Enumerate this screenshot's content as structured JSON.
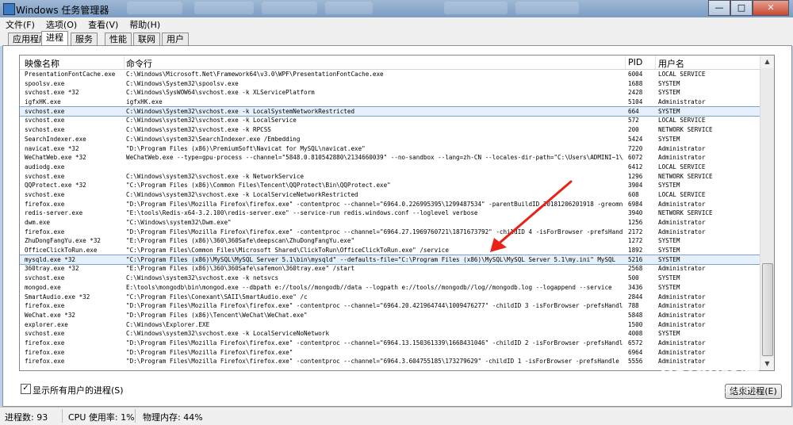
{
  "window": {
    "title": "Windows 任务管理器",
    "min": "—",
    "max": "□",
    "close": "✕"
  },
  "menu": [
    "文件(F)",
    "选项(O)",
    "查看(V)",
    "帮助(H)"
  ],
  "tabs": [
    "应用程序",
    "进程",
    "服务",
    "性能",
    "联网",
    "用户"
  ],
  "active_tab": 1,
  "columns": {
    "name": "映像名称",
    "cmd": "命令行",
    "pid": "PID",
    "user": "用户名"
  },
  "processes": [
    {
      "name": "PresentationFontCache.exe",
      "cmd": "C:\\Windows\\Microsoft.Net\\Framework64\\v3.0\\WPF\\PresentationFontCache.exe",
      "pid": "6004",
      "user": "LOCAL SERVICE"
    },
    {
      "name": "spoolsv.exe",
      "cmd": "C:\\Windows\\System32\\spoolsv.exe",
      "pid": "1688",
      "user": "SYSTEM"
    },
    {
      "name": "svchost.exe *32",
      "cmd": "C:\\Windows\\SysWOW64\\svchost.exe -k XLServicePlatform",
      "pid": "2428",
      "user": "SYSTEM"
    },
    {
      "name": "igfxHK.exe",
      "cmd": "igfxHK.exe",
      "pid": "5104",
      "user": "Administrator"
    },
    {
      "name": "svchost.exe",
      "cmd": "C:\\Windows\\System32\\svchost.exe -k LocalSystemNetworkRestricted",
      "pid": "664",
      "user": "SYSTEM"
    },
    {
      "name": "svchost.exe",
      "cmd": "C:\\Windows\\system32\\svchost.exe -k LocalService",
      "pid": "572",
      "user": "LOCAL SERVICE"
    },
    {
      "name": "svchost.exe",
      "cmd": "C:\\Windows\\system32\\svchost.exe -k RPCSS",
      "pid": "200",
      "user": "NETWORK SERVICE"
    },
    {
      "name": "SearchIndexer.exe",
      "cmd": "C:\\Windows\\system32\\SearchIndexer.exe /Embedding",
      "pid": "5424",
      "user": "SYSTEM"
    },
    {
      "name": "navicat.exe *32",
      "cmd": "\"D:\\Program Files (x86)\\PremiumSoft\\Navicat for MySQL\\navicat.exe\"",
      "pid": "7220",
      "user": "Administrator"
    },
    {
      "name": "WeChatWeb.exe *32",
      "cmd": "WeChatWeb.exe --type=gpu-process --channel=\"5848.0.810542880\\2134660039\" --no-sandbox --lang=zh-CN --locales-dir-path=\"C:\\Users\\ADMINI~1\\A...",
      "pid": "6072",
      "user": "Administrator"
    },
    {
      "name": "audiodg.exe",
      "cmd": "",
      "pid": "6412",
      "user": "LOCAL SERVICE"
    },
    {
      "name": "svchost.exe",
      "cmd": "C:\\Windows\\system32\\svchost.exe -k NetworkService",
      "pid": "1296",
      "user": "NETWORK SERVICE"
    },
    {
      "name": "QQProtect.exe *32",
      "cmd": "\"C:\\Program Files (x86)\\Common Files\\Tencent\\QQProtect\\Bin\\QQProtect.exe\"",
      "pid": "3904",
      "user": "SYSTEM"
    },
    {
      "name": "svchost.exe",
      "cmd": "C:\\Windows\\system32\\svchost.exe -k LocalServiceNetworkRestricted",
      "pid": "608",
      "user": "LOCAL SERVICE"
    },
    {
      "name": "firefox.exe",
      "cmd": "\"D:\\Program Files\\Mozilla Firefox\\firefox.exe\" -contentproc --channel=\"6964.0.226995395\\1299487534\" -parentBuildID 20181206201918 -greomni...",
      "pid": "6984",
      "user": "Administrator"
    },
    {
      "name": "redis-server.exe",
      "cmd": "\"E:\\tools\\Redis-x64-3.2.100\\redis-server.exe\" --service-run redis.windows.conf --loglevel verbose",
      "pid": "3940",
      "user": "NETWORK SERVICE"
    },
    {
      "name": "dwm.exe",
      "cmd": "\"C:\\Windows\\system32\\Dwm.exe\"",
      "pid": "1256",
      "user": "Administrator"
    },
    {
      "name": "firefox.exe",
      "cmd": "\"D:\\Program Files\\Mozilla Firefox\\firefox.exe\" -contentproc --channel=\"6964.27.1969760721\\1871673792\" -childID 4 -isForBrowser -prefsHandl...",
      "pid": "2172",
      "user": "Administrator"
    },
    {
      "name": "ZhuDongFangYu.exe *32",
      "cmd": "\"E:\\Program Files (x86)\\360\\360Safe\\deepscan\\ZhuDongFangYu.exe\"",
      "pid": "1272",
      "user": "SYSTEM"
    },
    {
      "name": "OfficeClickToRun.exe",
      "cmd": "\"C:\\Program Files\\Common Files\\Microsoft Shared\\ClickToRun\\OfficeClickToRun.exe\" /service",
      "pid": "1892",
      "user": "SYSTEM"
    },
    {
      "name": "mysqld.exe *32",
      "cmd": "\"C:\\Program Files (x86)\\MySQL\\MySQL Server 5.1\\bin\\mysqld\" --defaults-file=\"C:\\Program Files (x86)\\MySQL\\MySQL Server 5.1\\my.ini\" MySQL",
      "pid": "5216",
      "user": "SYSTEM"
    },
    {
      "name": "360tray.exe *32",
      "cmd": "\"E:\\Program Files (x86)\\360\\360Safe\\safemon\\360tray.exe\" /start",
      "pid": "2568",
      "user": "Administrator"
    },
    {
      "name": "svchost.exe",
      "cmd": "C:\\Windows\\system32\\svchost.exe -k netsvcs",
      "pid": "500",
      "user": "SYSTEM"
    },
    {
      "name": "mongod.exe",
      "cmd": "E:\\tools\\mongodb\\bin\\mongod.exe --dbpath e://tools//mongodb//data --logpath e://tools//mongodb//log//mongodb.log --logappend --service",
      "pid": "3436",
      "user": "SYSTEM"
    },
    {
      "name": "SmartAudio.exe *32",
      "cmd": "\"C:\\Program Files\\Conexant\\SAII\\SmartAudio.exe\" /c",
      "pid": "2844",
      "user": "Administrator"
    },
    {
      "name": "firefox.exe",
      "cmd": "\"D:\\Program Files\\Mozilla Firefox\\firefox.exe\" -contentproc --channel=\"6964.20.421964744\\1009476277\" -childID 3 -isForBrowser -prefsHandle...",
      "pid": "788",
      "user": "Administrator"
    },
    {
      "name": "WeChat.exe *32",
      "cmd": "\"D:\\Program Files (x86)\\Tencent\\WeChat\\WeChat.exe\"",
      "pid": "5848",
      "user": "Administrator"
    },
    {
      "name": "explorer.exe",
      "cmd": "C:\\Windows\\Explorer.EXE",
      "pid": "1500",
      "user": "Administrator"
    },
    {
      "name": "svchost.exe",
      "cmd": "C:\\Windows\\system32\\svchost.exe -k LocalServiceNoNetwork",
      "pid": "4008",
      "user": "SYSTEM"
    },
    {
      "name": "firefox.exe",
      "cmd": "\"D:\\Program Files\\Mozilla Firefox\\firefox.exe\" -contentproc --channel=\"6964.13.150361339\\1668431046\" -childID 2 -isForBrowser -prefsHandle...",
      "pid": "6572",
      "user": "Administrator"
    },
    {
      "name": "firefox.exe",
      "cmd": "\"D:\\Program Files\\Mozilla Firefox\\firefox.exe\"",
      "pid": "6964",
      "user": "Administrator"
    },
    {
      "name": "firefox.exe",
      "cmd": "\"D:\\Program Files\\Mozilla Firefox\\firefox.exe\" -contentproc --channel=\"6964.3.604755185\\173279629\" -childID 1 -isForBrowser -prefsHandle 2...",
      "pid": "5556",
      "user": "Administrator"
    }
  ],
  "selected_rows": [
    4,
    20
  ],
  "show_all_label": "显示所有用户的进程(S)",
  "show_all_checked": "✓",
  "end_process_label": "结束进程(E)",
  "status": {
    "processes": "进程数: 93",
    "cpu": "CPU 使用率: 1%",
    "memory": "物理内存: 44%"
  },
  "watermark": {
    "brand": "Baidu经验",
    "site": "jingyan.baidu.com"
  },
  "colors": {
    "arrow": "#e8231a",
    "selection": "#e6f0fa"
  }
}
